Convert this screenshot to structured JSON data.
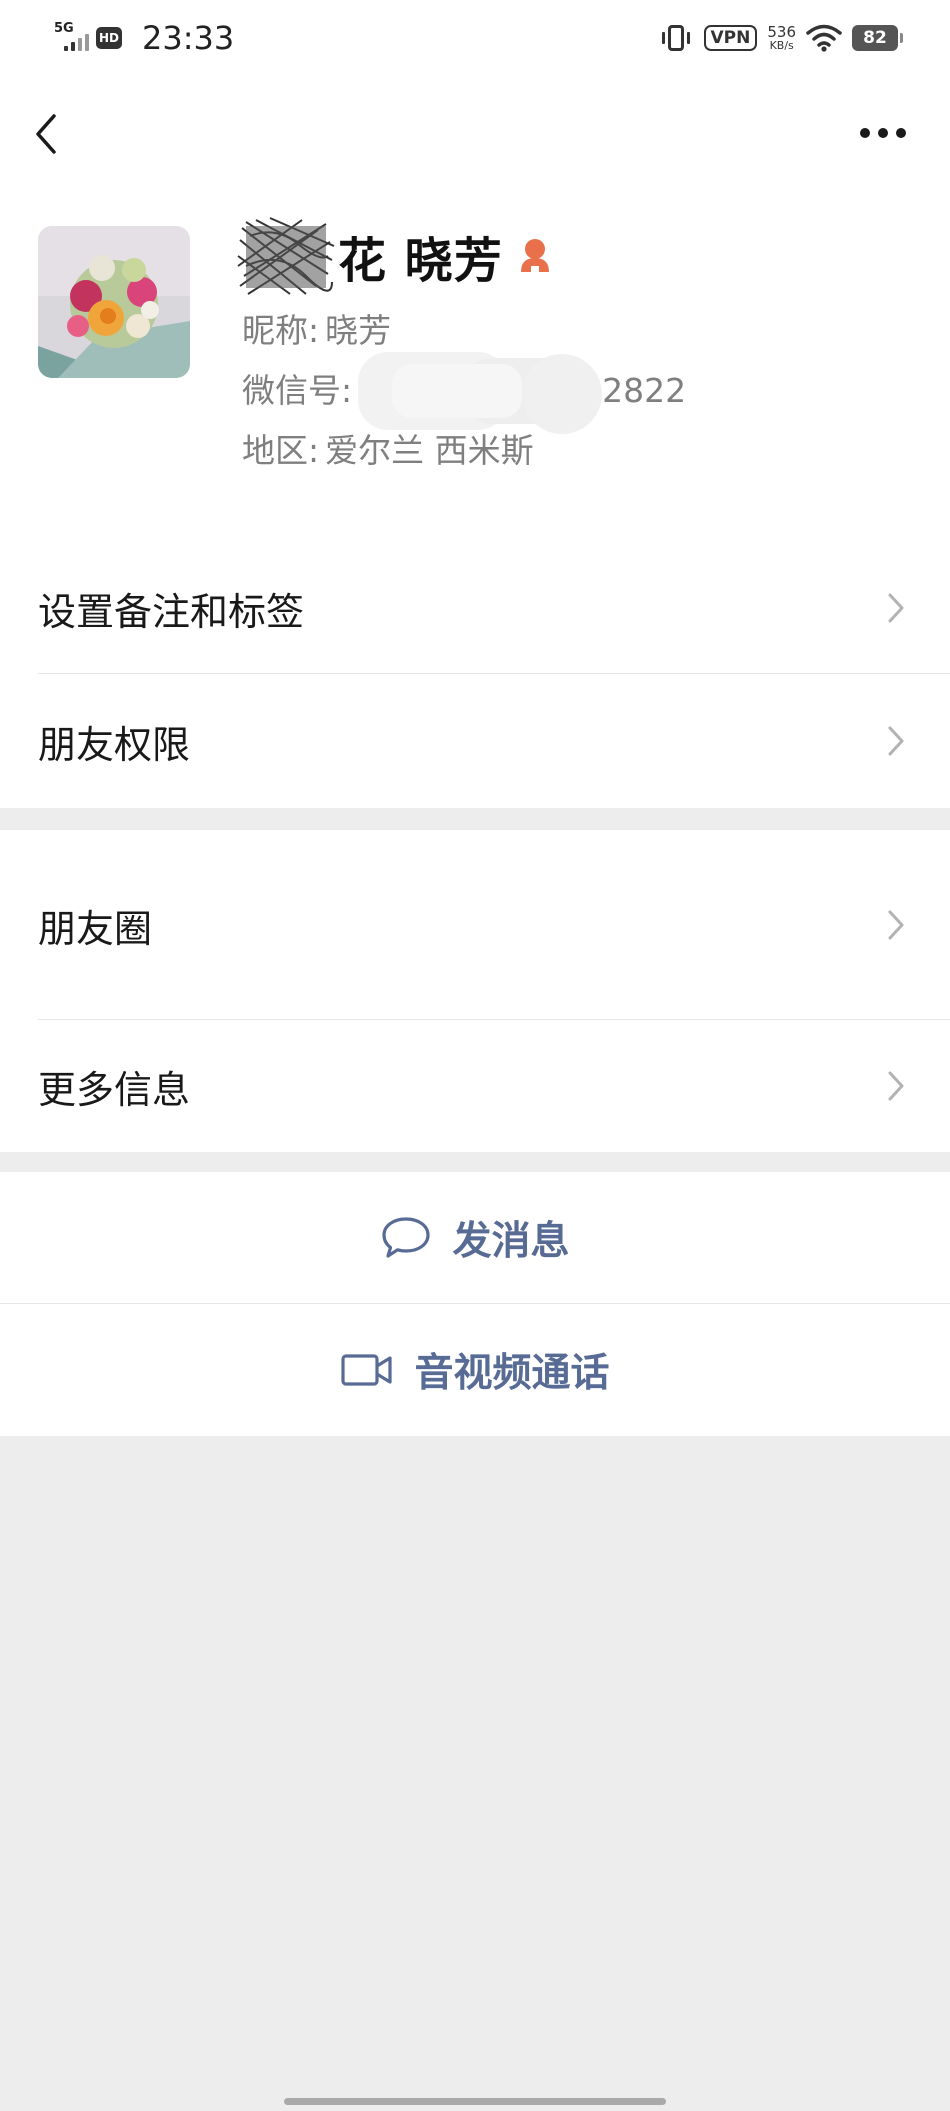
{
  "status_bar": {
    "network": "5G",
    "hd": "HD",
    "time": "23:33",
    "vpn": "VPN",
    "speed_value": "536",
    "speed_unit": "KB/s",
    "battery": "82"
  },
  "profile": {
    "name_visible": "花 晓芳",
    "nickname_label": "昵称:",
    "nickname_value": "晓芳",
    "wechat_id_label": "微信号:",
    "wechat_id_suffix": "2822",
    "region_label": "地区:",
    "region_value": "爱尔兰  西米斯"
  },
  "menu": {
    "set_remark": "设置备注和标签",
    "friend_permissions": "朋友权限",
    "moments": "朋友圈",
    "more_info": "更多信息"
  },
  "actions": {
    "send_message": "发消息",
    "video_call": "音视频通话"
  },
  "colors": {
    "link": "#576b95",
    "background": "#ededed",
    "gender_icon": "#e8704b"
  }
}
